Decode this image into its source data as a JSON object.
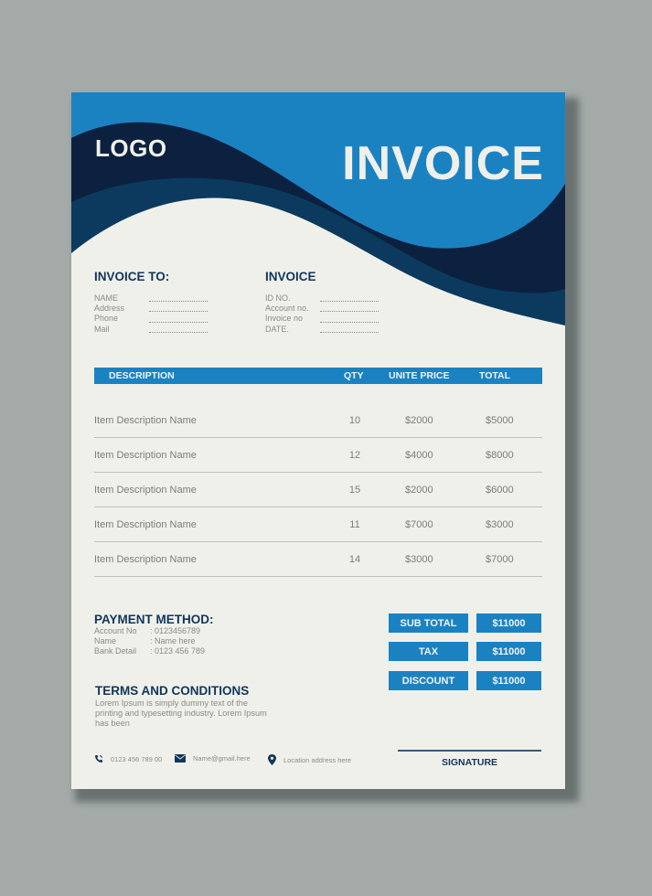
{
  "colors": {
    "brand_blue": "#1b82c2",
    "navy": "#0c2140",
    "mid_navy": "#0b3a5e",
    "paper": "#f0f0eb",
    "heading": "#11365a",
    "muted_text": "#8a8a86"
  },
  "header": {
    "logo": "LOGO",
    "title": "INVOICE"
  },
  "invoice_to": {
    "heading": "INVOICE TO:",
    "fields": [
      {
        "label": "NAME"
      },
      {
        "label": "Address"
      },
      {
        "label": "Phone"
      },
      {
        "label": "Mail"
      }
    ]
  },
  "invoice_info": {
    "heading": "INVOICE",
    "fields": [
      {
        "label": "ID NO."
      },
      {
        "label": "Account no."
      },
      {
        "label": "Invoice no"
      },
      {
        "label": "DATE."
      }
    ]
  },
  "table": {
    "columns": [
      "DESCRIPTION",
      "QTY",
      "UNITE PRICE",
      "TOTAL"
    ],
    "rows": [
      {
        "description": "Item Description Name",
        "qty": "10",
        "price": "$2000",
        "total": "$5000"
      },
      {
        "description": "Item Description Name",
        "qty": "12",
        "price": "$4000",
        "total": "$8000"
      },
      {
        "description": "Item Description Name",
        "qty": "15",
        "price": "$2000",
        "total": "$6000"
      },
      {
        "description": "Item Description Name",
        "qty": "11",
        "price": "$7000",
        "total": "$3000"
      },
      {
        "description": "Item Description Name",
        "qty": "14",
        "price": "$3000",
        "total": "$7000"
      }
    ]
  },
  "payment": {
    "heading": "PAYMENT METHOD:",
    "fields": [
      {
        "label": "Account No",
        "value": ": 0123456789"
      },
      {
        "label": "Name",
        "value": ": Name here"
      },
      {
        "label": "Bank Detail",
        "value": ": 0123 456 789"
      }
    ]
  },
  "terms": {
    "heading": "TERMS AND CONDITIONS",
    "text": "Lorem Ipsum is simply dummy text of the printing and typesetting industry. Lorem Ipsum has been"
  },
  "summary": [
    {
      "label": "SUB TOTAL",
      "value": "$11000"
    },
    {
      "label": "TAX",
      "value": "$11000"
    },
    {
      "label": "DISCOUNT",
      "value": "$11000"
    }
  ],
  "footer": {
    "phone": "0123 456 789 00",
    "email": "Name@gmail.here",
    "location": "Location address here",
    "phone_icon": "phone-icon",
    "email_icon": "envelope-icon",
    "location_icon": "map-pin-icon"
  },
  "signature": {
    "label": "SIGNATURE"
  }
}
